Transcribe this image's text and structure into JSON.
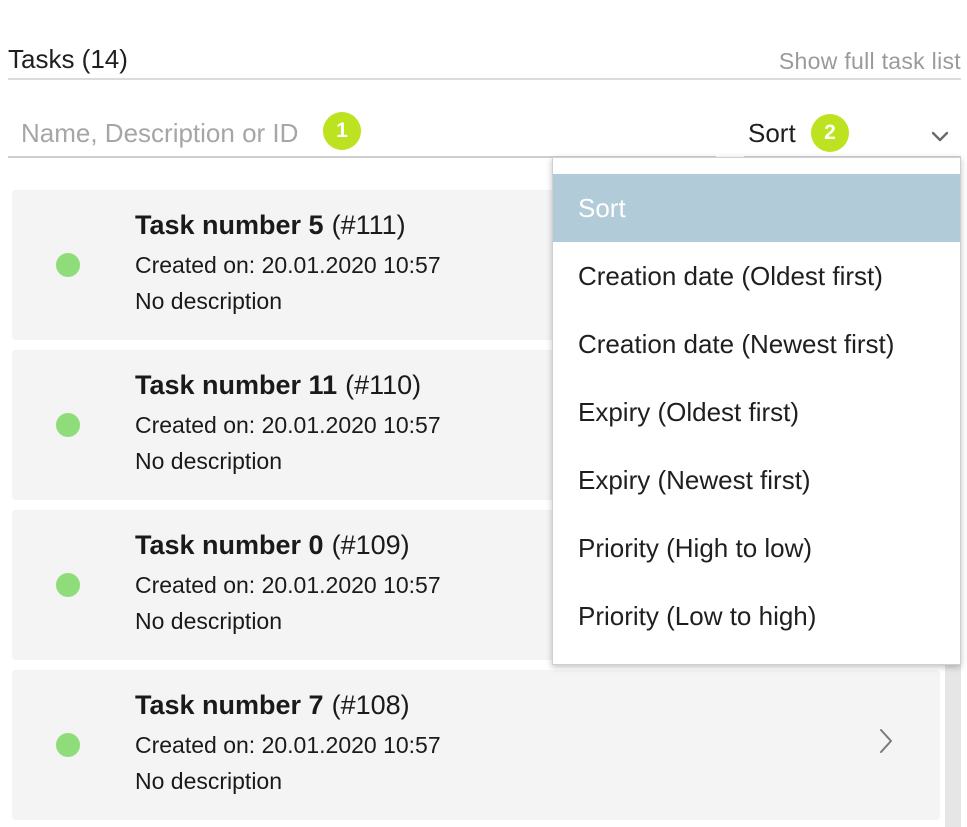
{
  "header": {
    "title": "Tasks (14)",
    "full_list_link": "Show full task list"
  },
  "search": {
    "placeholder": "Name, Description or ID",
    "badge": "1"
  },
  "sort": {
    "label": "Sort",
    "badge": "2",
    "icon": "chevron-down-icon"
  },
  "tasks": [
    {
      "name": "Task number 5",
      "id": "(#111)",
      "created": "Created on: 20.01.2020 10:57",
      "description": "No description",
      "status_color": "#8fdc7a"
    },
    {
      "name": "Task number 11",
      "id": "(#110)",
      "created": "Created on: 20.01.2020 10:57",
      "description": "No description",
      "status_color": "#8fdc7a"
    },
    {
      "name": "Task number 0",
      "id": "(#109)",
      "created": "Created on: 20.01.2020 10:57",
      "description": "No description",
      "status_color": "#8fdc7a"
    },
    {
      "name": "Task number 7",
      "id": "(#108)",
      "created": "Created on: 20.01.2020 10:57",
      "description": "No description",
      "status_color": "#8fdc7a"
    }
  ],
  "sort_menu": {
    "options": [
      "Sort",
      "Creation date (Oldest first)",
      "Creation date (Newest first)",
      "Expiry (Oldest first)",
      "Expiry (Newest first)",
      "Priority (High to low)",
      "Priority (Low to high)"
    ],
    "selected": "Sort"
  },
  "colors": {
    "badge": "#bde21f",
    "status_dot": "#8fdc7a",
    "selected_option": "#b2cbd8",
    "card_bg": "#f4f4f4"
  }
}
